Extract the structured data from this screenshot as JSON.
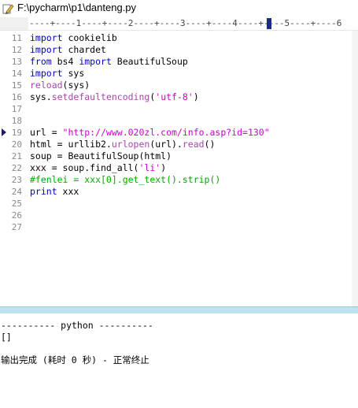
{
  "window": {
    "title": "F:\\pycharm\\p1\\danteng.py"
  },
  "ruler": {
    "text": "----+----1----+----2----+----3----+----4----+----5----+----6"
  },
  "editor": {
    "line_numbers": [
      "11",
      "12",
      "13",
      "14",
      "15",
      "16",
      "17",
      "18",
      "19",
      "20",
      "21",
      "22",
      "23",
      "24",
      "25",
      "26",
      "27"
    ],
    "lines": [
      [
        {
          "c": "kw",
          "t": "import"
        },
        {
          "c": "op",
          "t": " cookielib"
        }
      ],
      [
        {
          "c": "kw",
          "t": "import"
        },
        {
          "c": "op",
          "t": " chardet"
        }
      ],
      [
        {
          "c": "kw",
          "t": "from"
        },
        {
          "c": "op",
          "t": " bs4 "
        },
        {
          "c": "kw",
          "t": "import"
        },
        {
          "c": "op",
          "t": " BeautifulSoup"
        }
      ],
      [
        {
          "c": "kw",
          "t": "import"
        },
        {
          "c": "op",
          "t": " sys"
        }
      ],
      [
        {
          "c": "fn",
          "t": "reload"
        },
        {
          "c": "op",
          "t": "(sys)"
        }
      ],
      [
        {
          "c": "op",
          "t": "sys."
        },
        {
          "c": "fn",
          "t": "setdefaultencoding"
        },
        {
          "c": "op",
          "t": "("
        },
        {
          "c": "str",
          "t": "'utf-8'"
        },
        {
          "c": "op",
          "t": ")"
        }
      ],
      [],
      [],
      [
        {
          "c": "op",
          "t": "url = "
        },
        {
          "c": "str",
          "t": "\"http://www.020zl.com/info.asp?id=130\""
        }
      ],
      [
        {
          "c": "op",
          "t": "html = urllib2."
        },
        {
          "c": "fn",
          "t": "urlopen"
        },
        {
          "c": "op",
          "t": "(url)."
        },
        {
          "c": "fn",
          "t": "read"
        },
        {
          "c": "op",
          "t": "()"
        }
      ],
      [
        {
          "c": "op",
          "t": "soup = BeautifulSoup(html)"
        }
      ],
      [
        {
          "c": "op",
          "t": "xxx = soup.find_all("
        },
        {
          "c": "str",
          "t": "'li'"
        },
        {
          "c": "op",
          "t": ")"
        }
      ],
      [
        {
          "c": "cmt",
          "t": "#fenlei = xxx[0].get_text().strip()"
        }
      ],
      [
        {
          "c": "kw",
          "t": "print"
        },
        {
          "c": "op",
          "t": " xxx"
        }
      ],
      [],
      [],
      []
    ]
  },
  "output": {
    "header": "---------- python ----------",
    "result": "[]",
    "status": "输出完成 (耗时 0 秒) - 正常终止"
  }
}
